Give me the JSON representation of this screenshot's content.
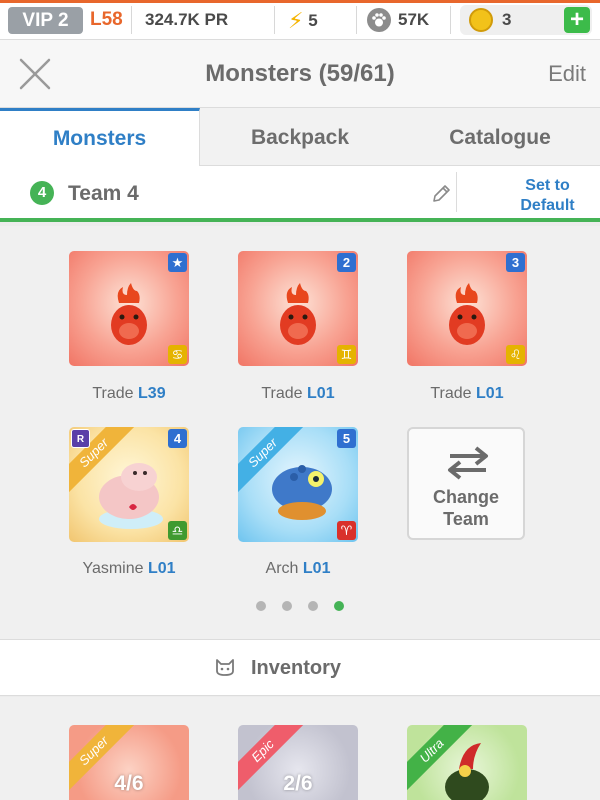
{
  "status_bar": {
    "vip": "VIP 2",
    "level": "L58",
    "power": "324.7K PR",
    "energy": "5",
    "paws": "57K",
    "coins": "3",
    "add_label": "+",
    "accent_color": "#e8672c"
  },
  "header": {
    "title": "Monsters (59/61)",
    "edit_label": "Edit",
    "close_icon": "close-icon"
  },
  "tabs": [
    {
      "label": "Monsters",
      "active": true
    },
    {
      "label": "Backpack",
      "active": false
    },
    {
      "label": "Catalogue",
      "active": false
    }
  ],
  "team": {
    "number": "4",
    "name": "Team 4",
    "set_default_label": "Set to\nDefault",
    "accent_color": "#45b356"
  },
  "monsters": [
    {
      "name": "Trade",
      "level": "L39",
      "slot": "★",
      "rarity": "",
      "zodiac": "♋",
      "zodiac_color": "#e5b300",
      "theme": "red"
    },
    {
      "name": "Trade",
      "level": "L01",
      "slot": "2",
      "rarity": "",
      "zodiac": "♊",
      "zodiac_color": "#e5b300",
      "theme": "red"
    },
    {
      "name": "Trade",
      "level": "L01",
      "slot": "3",
      "rarity": "",
      "zodiac": "♌",
      "zodiac_color": "#e5b300",
      "theme": "red"
    },
    {
      "name": "Yasmine",
      "level": "L01",
      "slot": "4",
      "rarity": "Super",
      "badge": "R",
      "zodiac": "♎",
      "zodiac_color": "#3f9a2f",
      "theme": "yellow"
    },
    {
      "name": "Arch",
      "level": "L01",
      "slot": "5",
      "rarity": "Super",
      "zodiac": "♈",
      "zodiac_color": "#d9312b",
      "theme": "blue"
    }
  ],
  "change_team": {
    "label": "Change\nTeam",
    "icon": "swap-arrows-icon"
  },
  "pagination": {
    "pages": 4,
    "current": 4
  },
  "inventory": {
    "label": "Inventory",
    "items": [
      {
        "rarity": "Super",
        "count": "4/6"
      },
      {
        "rarity": "Epic",
        "count": "2/6"
      },
      {
        "rarity": "Ultra",
        "count": ""
      }
    ]
  }
}
